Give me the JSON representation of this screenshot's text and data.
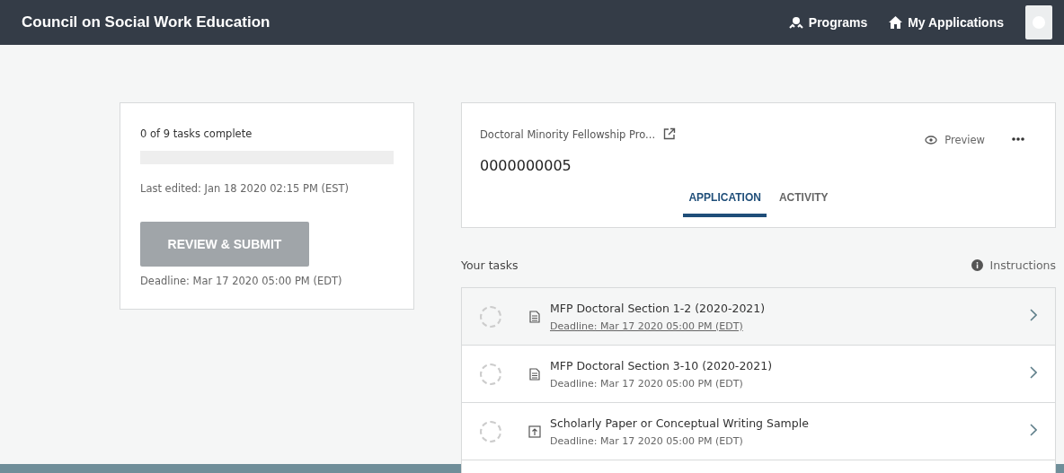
{
  "header": {
    "title": "Council on Social Work Education",
    "nav": [
      {
        "label": "Programs",
        "kind": "programs"
      },
      {
        "label": "My Applications",
        "kind": "home"
      }
    ]
  },
  "progress": {
    "summary": "0 of 9 tasks complete",
    "level": 0,
    "last_edited": "Last edited: Jan 18 2020 02:15 PM (EST)",
    "button": {
      "label": "REVIEW & SUBMIT",
      "disabled": true
    },
    "deadline": "Deadline: Mar 17 2020 05:00 PM (EDT)"
  },
  "application": {
    "program": "Doctoral Minority Fellowship Pro...",
    "number": "0000000005",
    "preview": "Preview",
    "tabs": [
      {
        "label": "APPLICATION",
        "selected": true
      },
      {
        "label": "ACTIVITY",
        "selected": false
      }
    ]
  },
  "tasks": {
    "heading": "Your tasks",
    "instructions": "Instructions",
    "items": [
      {
        "title": "MFP Doctoral Section 1-2 (2020-2021)",
        "deadline": "Deadline: Mar 17 2020 05:00 PM (EDT)",
        "kind": "document",
        "hovered": true,
        "complete": false
      },
      {
        "title": "MFP Doctoral Section 3-10 (2020-2021)",
        "deadline": "Deadline: Mar 17 2020 05:00 PM (EDT)",
        "kind": "document",
        "hovered": false,
        "complete": false
      },
      {
        "title": "Scholarly Paper or Conceptual Writing Sample",
        "deadline": "Deadline: Mar 17 2020 05:00 PM (EDT)",
        "kind": "upload",
        "hovered": false,
        "complete": false
      }
    ]
  }
}
